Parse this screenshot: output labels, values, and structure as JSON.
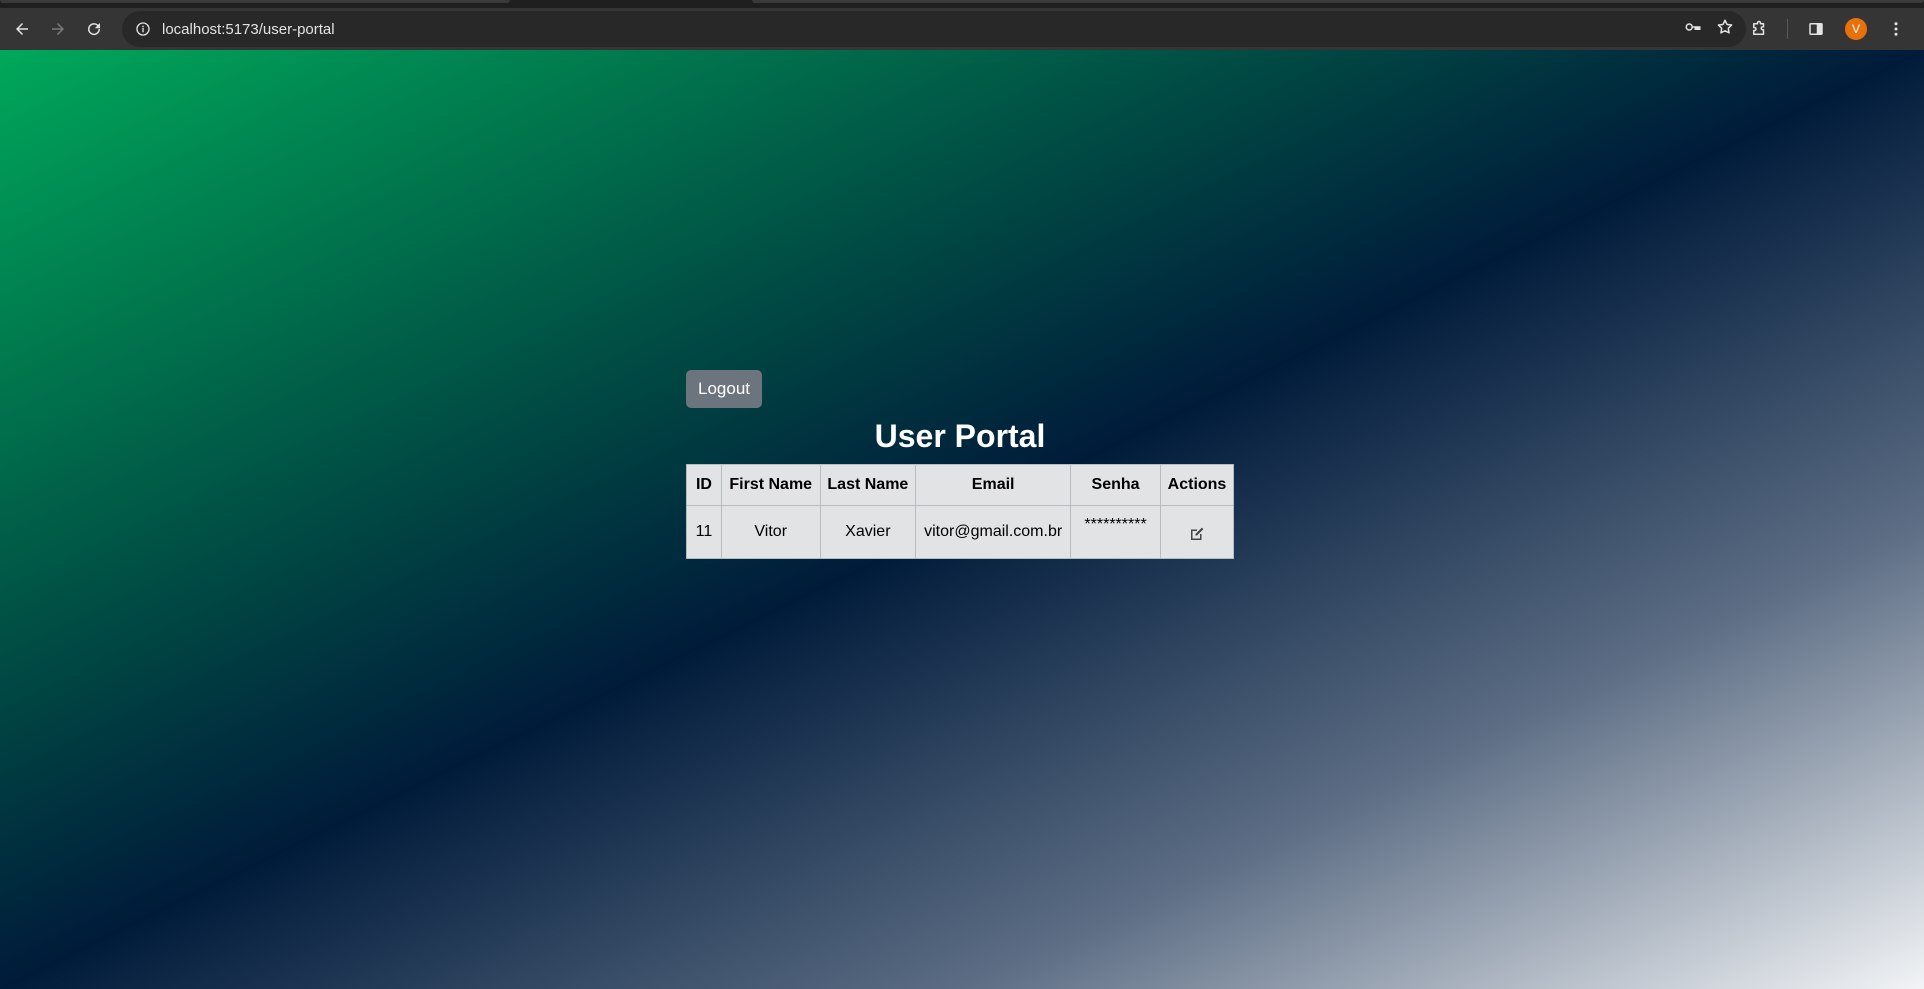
{
  "browser": {
    "url": "localhost:5173/user-portal",
    "avatar_letter": "V",
    "avatar_color": "#e8710a"
  },
  "page": {
    "logout_label": "Logout",
    "title": "User Portal",
    "table": {
      "headers": [
        "ID",
        "First Name",
        "Last Name",
        "Email",
        "Senha",
        "Actions"
      ],
      "rows": [
        {
          "id": "11",
          "first_name": "Vitor",
          "last_name": "Xavier",
          "email": "vitor@gmail.com.br",
          "senha": "**********",
          "action_icon": "edit-icon"
        }
      ]
    },
    "colors": {
      "button": "#6c757d",
      "gradient_start": "#00a85a",
      "gradient_mid": "#001b3a",
      "gradient_end": "#f2f4f6"
    }
  }
}
